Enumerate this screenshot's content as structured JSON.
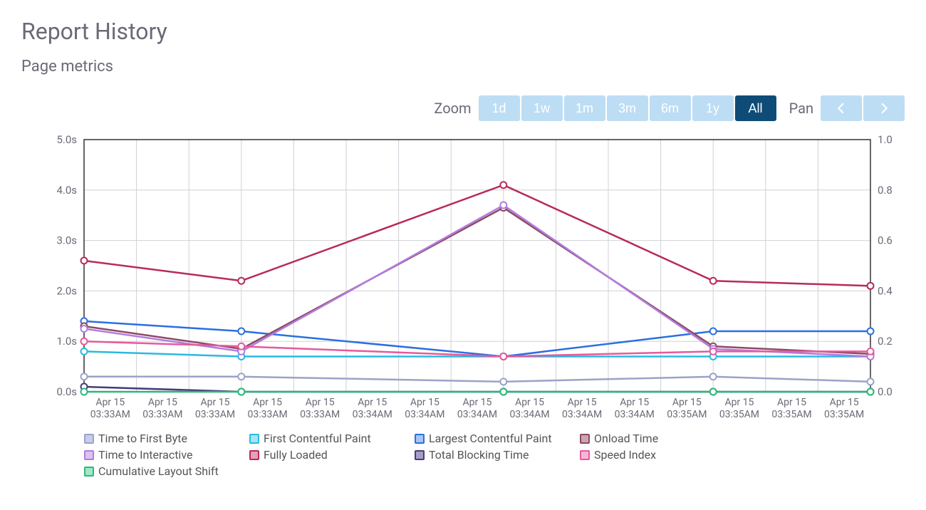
{
  "page_title": "Report History",
  "subtitle": "Page metrics",
  "zoom_label": "Zoom",
  "pan_label": "Pan",
  "zoom_options": [
    "1d",
    "1w",
    "1m",
    "3m",
    "6m",
    "1y",
    "All"
  ],
  "zoom_selected": "All",
  "chart_data": {
    "type": "line",
    "categories": [
      {
        "date": "Apr 15",
        "time": "03:33AM"
      },
      {
        "date": "Apr 15",
        "time": "03:33AM"
      },
      {
        "date": "Apr 15",
        "time": "03:33AM"
      },
      {
        "date": "Apr 15",
        "time": "03:33AM"
      },
      {
        "date": "Apr 15",
        "time": "03:33AM"
      },
      {
        "date": "Apr 15",
        "time": "03:34AM"
      },
      {
        "date": "Apr 15",
        "time": "03:34AM"
      },
      {
        "date": "Apr 15",
        "time": "03:34AM"
      },
      {
        "date": "Apr 15",
        "time": "03:34AM"
      },
      {
        "date": "Apr 15",
        "time": "03:34AM"
      },
      {
        "date": "Apr 15",
        "time": "03:34AM"
      },
      {
        "date": "Apr 15",
        "time": "03:35AM"
      },
      {
        "date": "Apr 15",
        "time": "03:35AM"
      },
      {
        "date": "Apr 15",
        "time": "03:35AM"
      },
      {
        "date": "Apr 15",
        "time": "03:35AM"
      }
    ],
    "x_markers": [
      0,
      3,
      8,
      12,
      15
    ],
    "y_left": {
      "ticks": [
        0,
        1,
        2,
        3,
        4,
        5
      ],
      "tick_labels": [
        "0.0s",
        "1.0s",
        "2.0s",
        "3.0s",
        "4.0s",
        "5.0s"
      ],
      "min": 0,
      "max": 5
    },
    "y_right": {
      "ticks": [
        0,
        0.2,
        0.4,
        0.6,
        0.8,
        1.0
      ],
      "tick_labels": [
        "0.0",
        "0.2",
        "0.4",
        "0.6",
        "0.8",
        "1.0"
      ],
      "min": 0,
      "max": 1
    },
    "series": [
      {
        "name": "Time to First Byte",
        "color": "#9aa3c8",
        "fill": "#c7cee6",
        "axis": "left",
        "values_at_markers": [
          0.3,
          0.3,
          0.2,
          0.3,
          0.2
        ]
      },
      {
        "name": "First Contentful Paint",
        "color": "#2bb9e0",
        "fill": "#a7e4f3",
        "axis": "left",
        "values_at_markers": [
          0.8,
          0.7,
          0.7,
          0.7,
          0.7
        ]
      },
      {
        "name": "Largest Contentful Paint",
        "color": "#2b6fe0",
        "fill": "#a7c6f3",
        "axis": "left",
        "values_at_markers": [
          1.4,
          1.2,
          0.7,
          1.2,
          1.2
        ]
      },
      {
        "name": "Onload Time",
        "color": "#8d4a62",
        "fill": "#caa5b3",
        "axis": "left",
        "values_at_markers": [
          1.3,
          0.85,
          3.65,
          0.9,
          0.75
        ]
      },
      {
        "name": "Time to Interactive",
        "color": "#b27ce0",
        "fill": "#dcc2f3",
        "axis": "left",
        "values_at_markers": [
          1.25,
          0.8,
          3.7,
          0.85,
          0.7
        ]
      },
      {
        "name": "Fully Loaded",
        "color": "#b82a5a",
        "fill": "#e6a0ba",
        "axis": "left",
        "values_at_markers": [
          2.6,
          2.2,
          4.1,
          2.2,
          2.1
        ]
      },
      {
        "name": "Total Blocking Time",
        "color": "#4b3a7a",
        "fill": "#a79ec6",
        "axis": "left",
        "values_at_markers": [
          0.1,
          0.0,
          0.0,
          0.0,
          0.0
        ]
      },
      {
        "name": "Speed Index",
        "color": "#e65a9c",
        "fill": "#f6b7d5",
        "axis": "left",
        "values_at_markers": [
          1.0,
          0.9,
          0.7,
          0.8,
          0.8
        ]
      },
      {
        "name": "Cumulative Layout Shift",
        "color": "#2bb87a",
        "fill": "#a5e6cb",
        "axis": "right",
        "values_at_markers": [
          0.0,
          0.0,
          0.0,
          0.0,
          0.0
        ]
      }
    ]
  }
}
